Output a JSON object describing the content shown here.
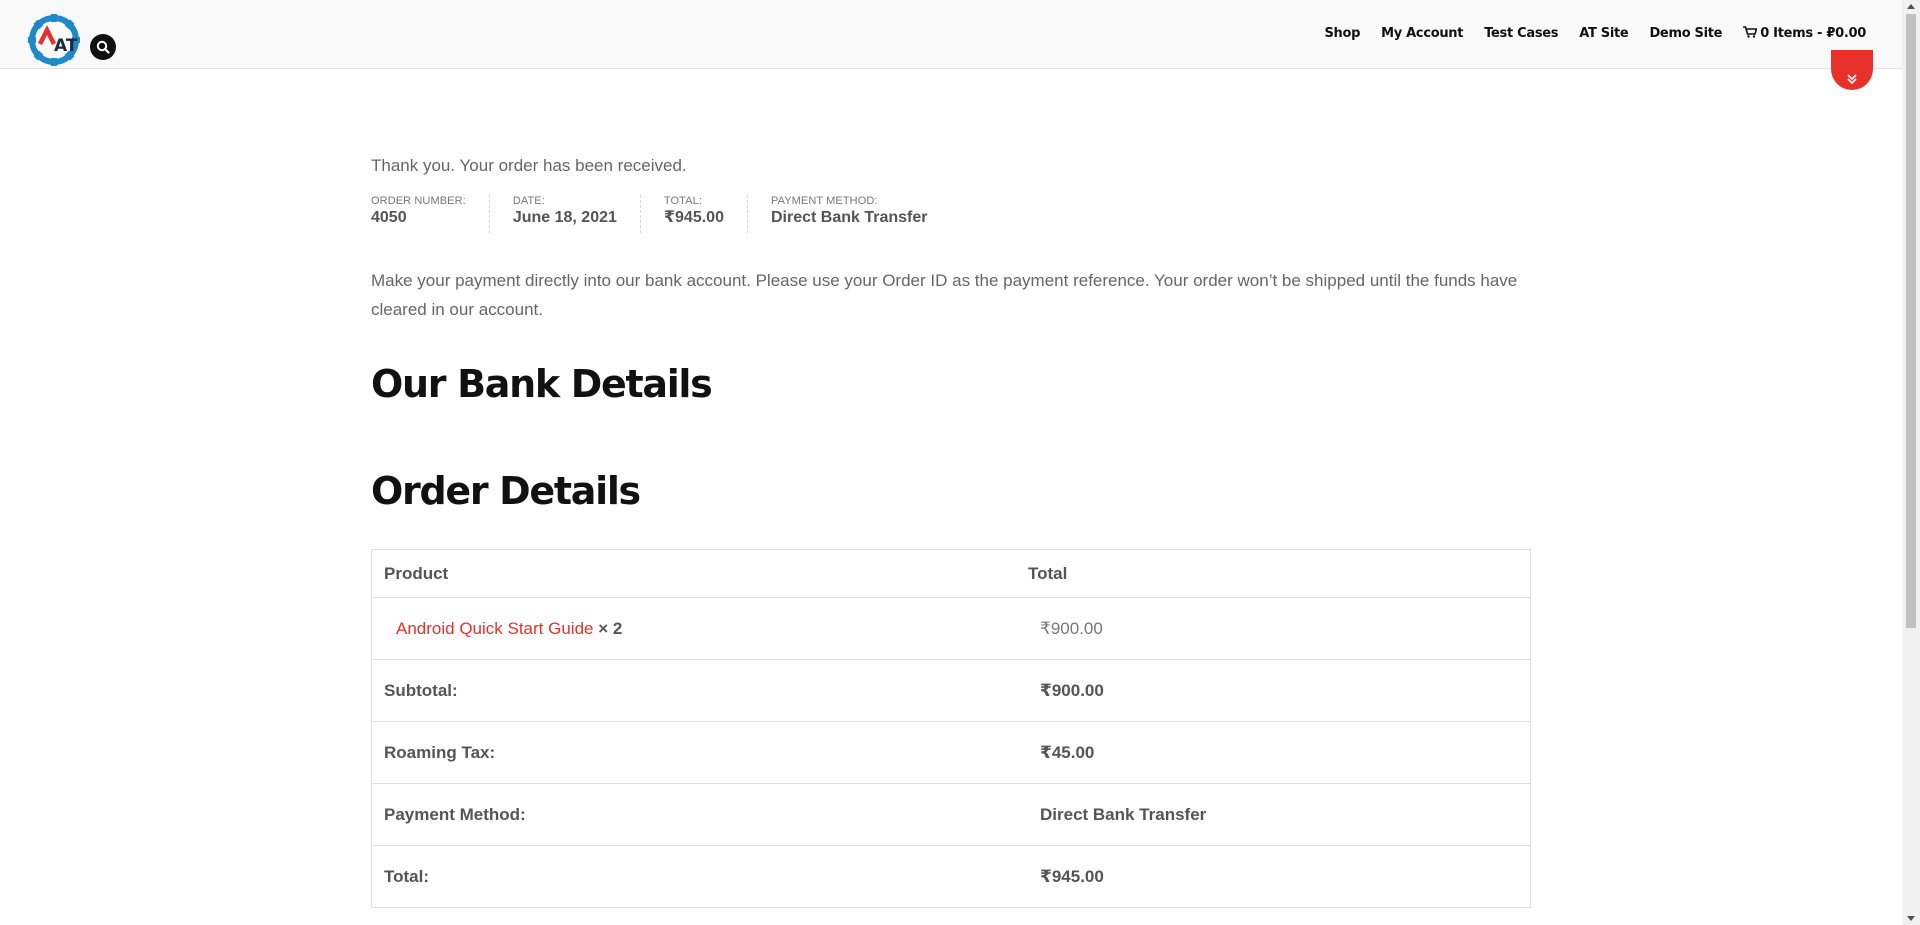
{
  "header": {
    "nav": [
      "Shop",
      "My Account",
      "Test Cases",
      "AT Site",
      "Demo Site"
    ],
    "cart_label": "0 Items - ₽0.00",
    "icons": {
      "logo": "automationtesting-gear-logo",
      "search": "search-icon",
      "cart": "cart-icon",
      "scroll": "chevron-double-down-icon"
    },
    "colors": {
      "accent": "#e8312b",
      "logo_blue": "#1e88c9"
    }
  },
  "logo": {
    "text": "AT"
  },
  "order": {
    "notice": "Thank you. Your order has been received.",
    "overview": [
      {
        "label": "ORDER NUMBER:",
        "value": "4050"
      },
      {
        "label": "DATE:",
        "value": "June 18, 2021"
      },
      {
        "label": "TOTAL:",
        "value": "₹945.00"
      },
      {
        "label": "PAYMENT METHOD:",
        "value": "Direct Bank Transfer"
      }
    ],
    "instructions": "Make your payment directly into our bank account. Please use your Order ID as the payment reference. Your order won’t be shipped until the funds have cleared in our account.",
    "bank_heading": "Our Bank Details",
    "details_heading": "Order Details",
    "table": {
      "headers": [
        "Product",
        "Total"
      ],
      "item": {
        "name": "Android Quick Start Guide",
        "qty": "× 2",
        "total": "₹900.00"
      },
      "rows": [
        {
          "label": "Subtotal:",
          "value": "₹900.00"
        },
        {
          "label": "Roaming Tax:",
          "value": "₹45.00"
        },
        {
          "label": "Payment Method:",
          "value": "Direct Bank Transfer"
        },
        {
          "label": "Total:",
          "value": "₹945.00"
        }
      ]
    }
  }
}
